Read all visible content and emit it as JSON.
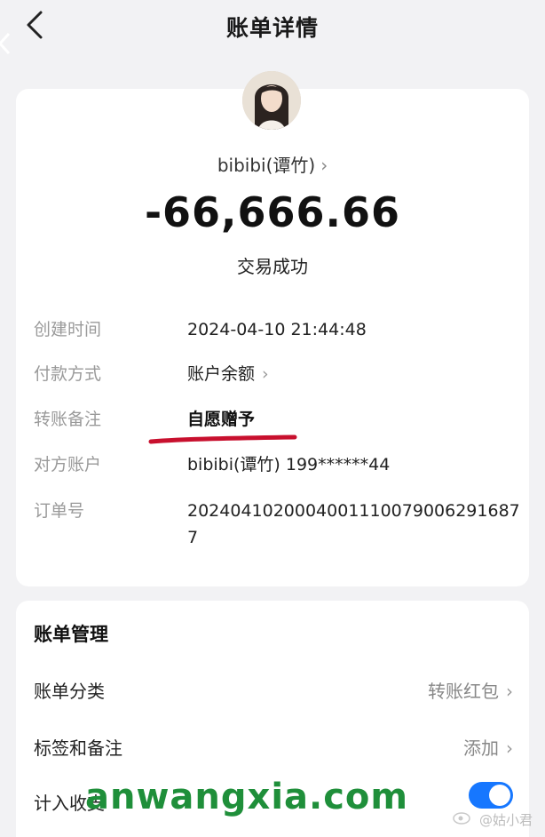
{
  "header": {
    "title": "账单详情"
  },
  "payee": {
    "name": "bibibi(谭竹)",
    "chevron": "›"
  },
  "amount": "-66,666.66",
  "status": "交易成功",
  "details": [
    {
      "label": "创建时间",
      "value": "2024-04-10 21:44:48"
    },
    {
      "label": "付款方式",
      "value": "账户余额",
      "chevron": "›"
    },
    {
      "label": "转账备注",
      "value": "自愿赠予"
    },
    {
      "label": "对方账户",
      "value": "bibibi(谭竹) 199******44"
    },
    {
      "label": "订单号",
      "value": "20240410200040011100790062916877"
    }
  ],
  "manage": {
    "title": "账单管理",
    "rows": [
      {
        "label": "账单分类",
        "value": "转账红包",
        "chevron": "›"
      },
      {
        "label": "标签和备注",
        "value": "添加",
        "chevron": "›"
      },
      {
        "label": "计入收支",
        "toggle_on": true
      }
    ]
  },
  "watermarks": {
    "site": "anwangxia.com",
    "weibo": "@姑小君"
  },
  "colors": {
    "accent": "#1677ff",
    "annotation_red": "#c8102e",
    "watermark_green": "#1f8f3a"
  },
  "icons": {
    "back": "chevron-left-icon",
    "toggle": "toggle-switch-icon"
  }
}
